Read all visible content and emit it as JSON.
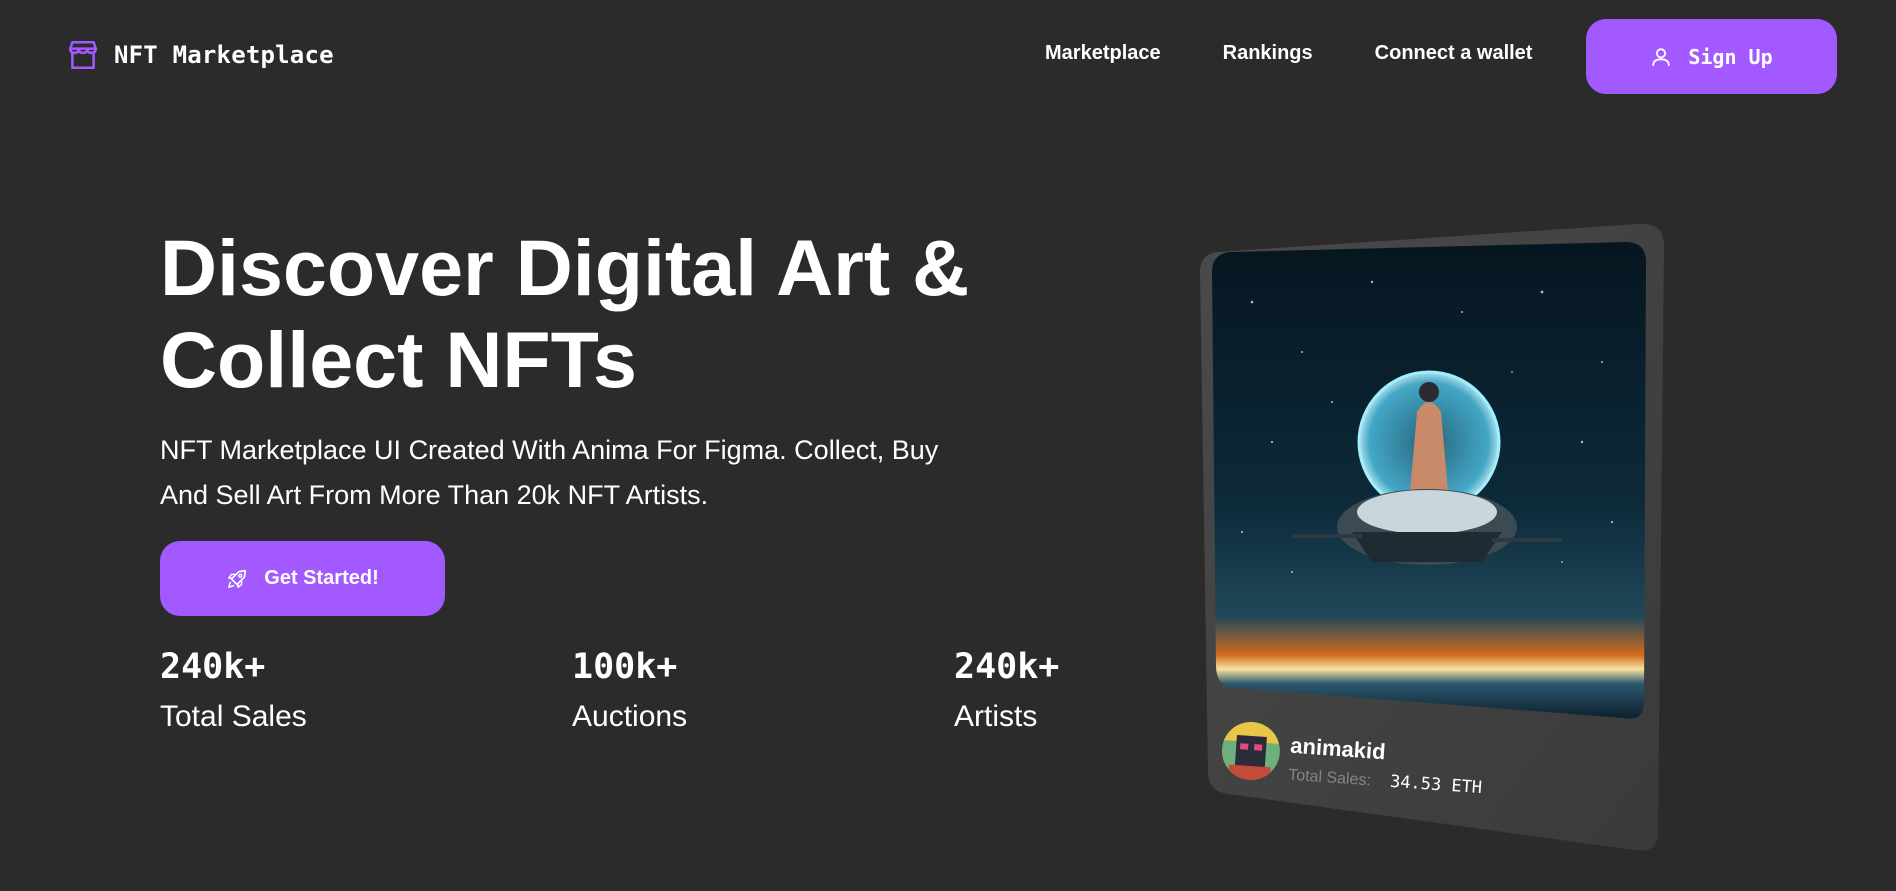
{
  "header": {
    "brand": "NFT Marketplace",
    "brand_icon": "storefront-icon",
    "nav": [
      "Marketplace",
      "Rankings",
      "Connect a wallet"
    ],
    "signup_label": "Sign Up",
    "signup_icon": "user-icon"
  },
  "hero": {
    "title_line1": "Discover Digital Art &",
    "title_line2": "Collect NFTs",
    "subtitle_line1": "NFT Marketplace UI Created With Anima For Figma. Collect, Buy",
    "subtitle_line2": "And Sell Art From More Than 20k NFT Artists.",
    "cta_label": "Get Started!",
    "cta_icon": "rocket-icon"
  },
  "stats": [
    {
      "value": "240k+",
      "label": "Total Sales"
    },
    {
      "value": "100k+",
      "label": "Auctions"
    },
    {
      "value": "240k+",
      "label": "Artists"
    }
  ],
  "card": {
    "artist": "animakid",
    "sales_label": "Total Sales:",
    "sales_value": "34.53 ETH"
  },
  "colors": {
    "background": "#2b2b2b",
    "accent": "#a259ff",
    "card_bg": "#3b3b3b",
    "muted": "#858584"
  }
}
